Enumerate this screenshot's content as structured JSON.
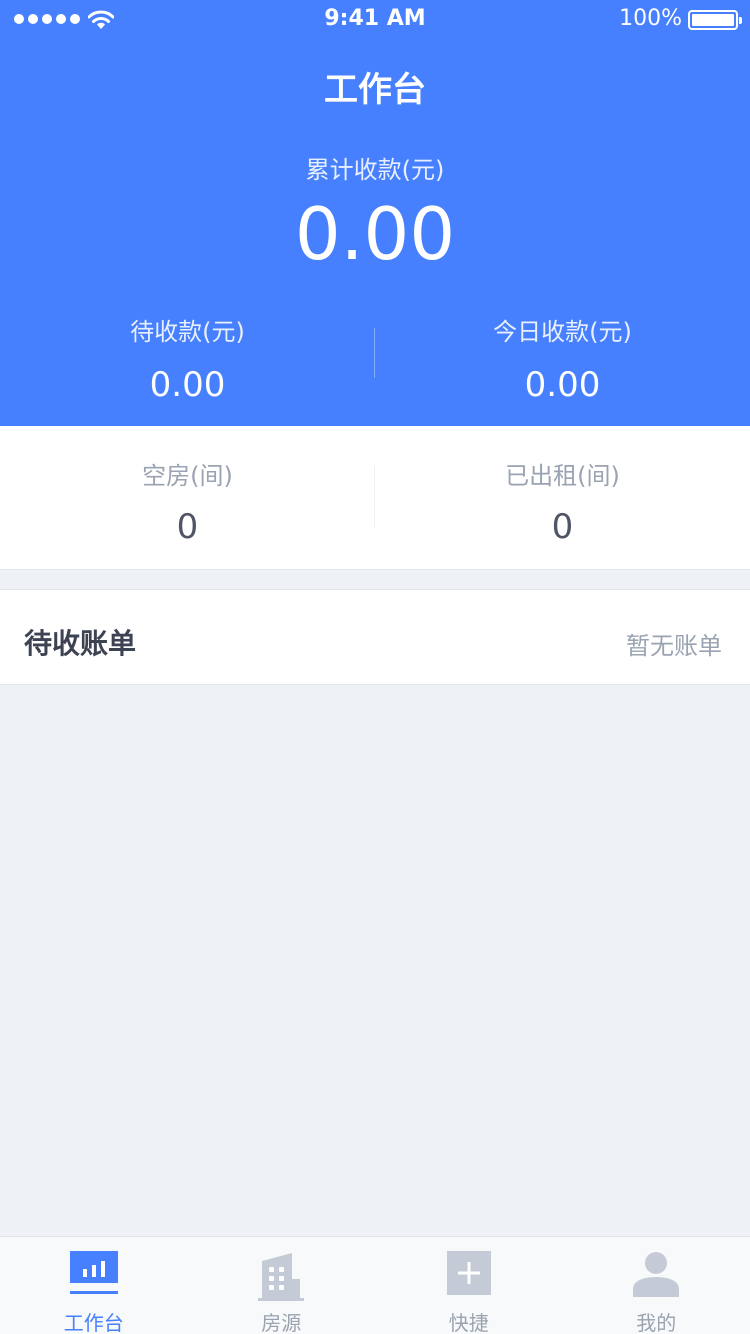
{
  "status_bar": {
    "time": "9:41 AM",
    "battery": "100%"
  },
  "header": {
    "title": "工作台",
    "total_label": "累计收款(元)",
    "total_value": "0.00",
    "pending_label": "待收款(元)",
    "pending_value": "0.00",
    "today_label": "今日收款(元)",
    "today_value": "0.00"
  },
  "rooms": {
    "vacant_label": "空房(间)",
    "vacant_value": "0",
    "rented_label": "已出租(间)",
    "rented_value": "0"
  },
  "bills": {
    "title": "待收账单",
    "empty_text": "暂无账单"
  },
  "tabbar": {
    "tabs": [
      {
        "label": "工作台",
        "icon": "workbench-chart-icon",
        "active": true
      },
      {
        "label": "房源",
        "icon": "building-icon",
        "active": false
      },
      {
        "label": "快捷",
        "icon": "plus-icon",
        "active": false
      },
      {
        "label": "我的",
        "icon": "user-icon",
        "active": false
      }
    ]
  },
  "colors": {
    "primary": "#4680fe",
    "background": "#eef1f6",
    "muted_text": "#9aa3b1",
    "dark_text": "#3d4352",
    "inactive_icon": "#c5cbd6"
  }
}
